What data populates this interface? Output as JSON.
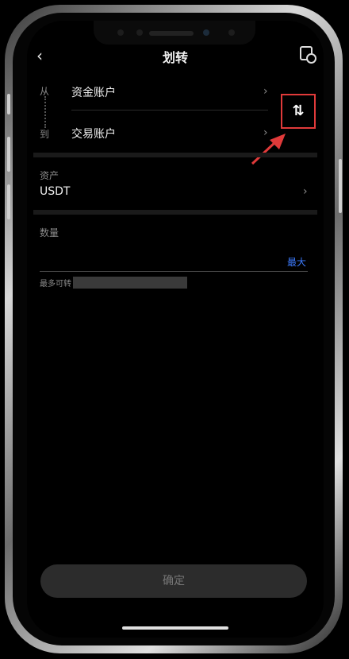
{
  "header": {
    "title": "划转",
    "back_icon": "chevron-left-icon",
    "history_icon": "history-icon"
  },
  "transfer": {
    "from_label": "从",
    "to_label": "到",
    "from_account": "资金账户",
    "to_account": "交易账户",
    "swap_symbol": "⇅"
  },
  "asset": {
    "label": "资产",
    "value": "USDT"
  },
  "amount": {
    "label": "数量",
    "placeholder": "",
    "max_label": "最大"
  },
  "available": {
    "label": "最多可转"
  },
  "confirm_label": "确定",
  "colors": {
    "accent": "#3d7bff",
    "highlight": "#e03a3a"
  }
}
